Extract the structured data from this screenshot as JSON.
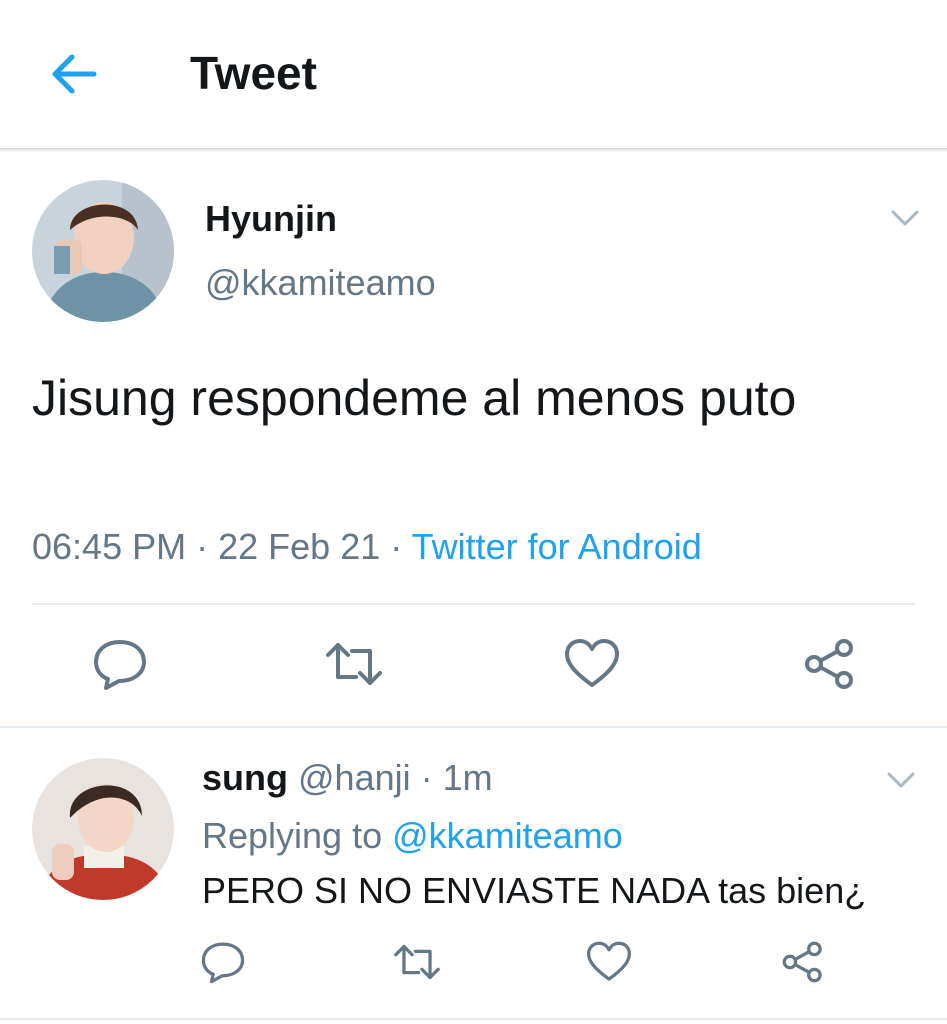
{
  "header": {
    "title": "Tweet",
    "back_icon": "arrow-left-icon",
    "accent": "#1da1f2"
  },
  "tweet": {
    "author_name": "Hyunjin",
    "author_handle": "@kkamiteamo",
    "text": "Jisung respondeme al menos puto",
    "time": "06:45 PM",
    "date": "22 Feb 21",
    "separator": "·",
    "source": "Twitter for Android",
    "menu_icon": "chevron-down-icon",
    "actions": [
      "reply-icon",
      "retweet-icon",
      "like-icon",
      "share-icon"
    ]
  },
  "reply": {
    "author_name": "sung",
    "author_handle": "@hanji",
    "separator": "·",
    "age": "1m",
    "replying_prefix": "Replying to",
    "replying_to": "@kkamiteamo",
    "text": "PERO SI NO ENVIASTE NADA tas bien¿",
    "menu_icon": "chevron-down-icon",
    "actions": [
      "reply-icon",
      "retweet-icon",
      "like-icon",
      "share-icon"
    ]
  },
  "colors": {
    "text": "#14171a",
    "muted": "#657786",
    "link": "#1da1f2",
    "divider": "#e6ecf0"
  }
}
